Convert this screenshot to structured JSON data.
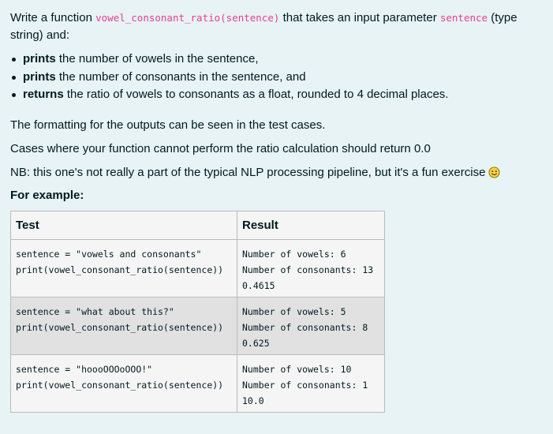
{
  "intro": {
    "prefix": "Write a function ",
    "function_signature": "vowel_consonant_ratio(sentence)",
    "middle": " that takes an input parameter ",
    "param": "sentence",
    "suffix": " (type string) and:"
  },
  "bullets": [
    {
      "bold": "prints",
      "text": " the number of vowels in the sentence,"
    },
    {
      "bold": "prints",
      "text": " the number of consonants in the sentence, and"
    },
    {
      "bold": "returns",
      "text": " the ratio of vowels to consonants as a float, rounded to 4 decimal places."
    }
  ],
  "paragraphs": {
    "formatting": "The formatting for the outputs can be seen in the test cases.",
    "cases": "Cases where your function cannot perform the ratio calculation should return 0.0",
    "note": "NB: this one's not really a part of the typical NLP processing pipeline, but it's a fun exercise"
  },
  "smiley_icon": "smiley-face-icon",
  "example_heading": "For example:",
  "table": {
    "headers": {
      "test": "Test",
      "result": "Result"
    },
    "rows": [
      {
        "test": "sentence = \"vowels and consonants\"\nprint(vowel_consonant_ratio(sentence))",
        "result": "Number of vowels: 6\nNumber of consonants: 13\n0.4615"
      },
      {
        "test": "sentence = \"what about this?\"\nprint(vowel_consonant_ratio(sentence))",
        "result": "Number of vowels: 5\nNumber of consonants: 8\n0.625"
      },
      {
        "test": "sentence = \"hoooOOOoOOO!\"\nprint(vowel_consonant_ratio(sentence))",
        "result": "Number of vowels: 10\nNumber of consonants: 1\n10.0"
      }
    ]
  },
  "colors": {
    "background": "#e7f3f5",
    "code_pink": "#e83e8c",
    "smiley_yellow": "#ffd43b"
  }
}
